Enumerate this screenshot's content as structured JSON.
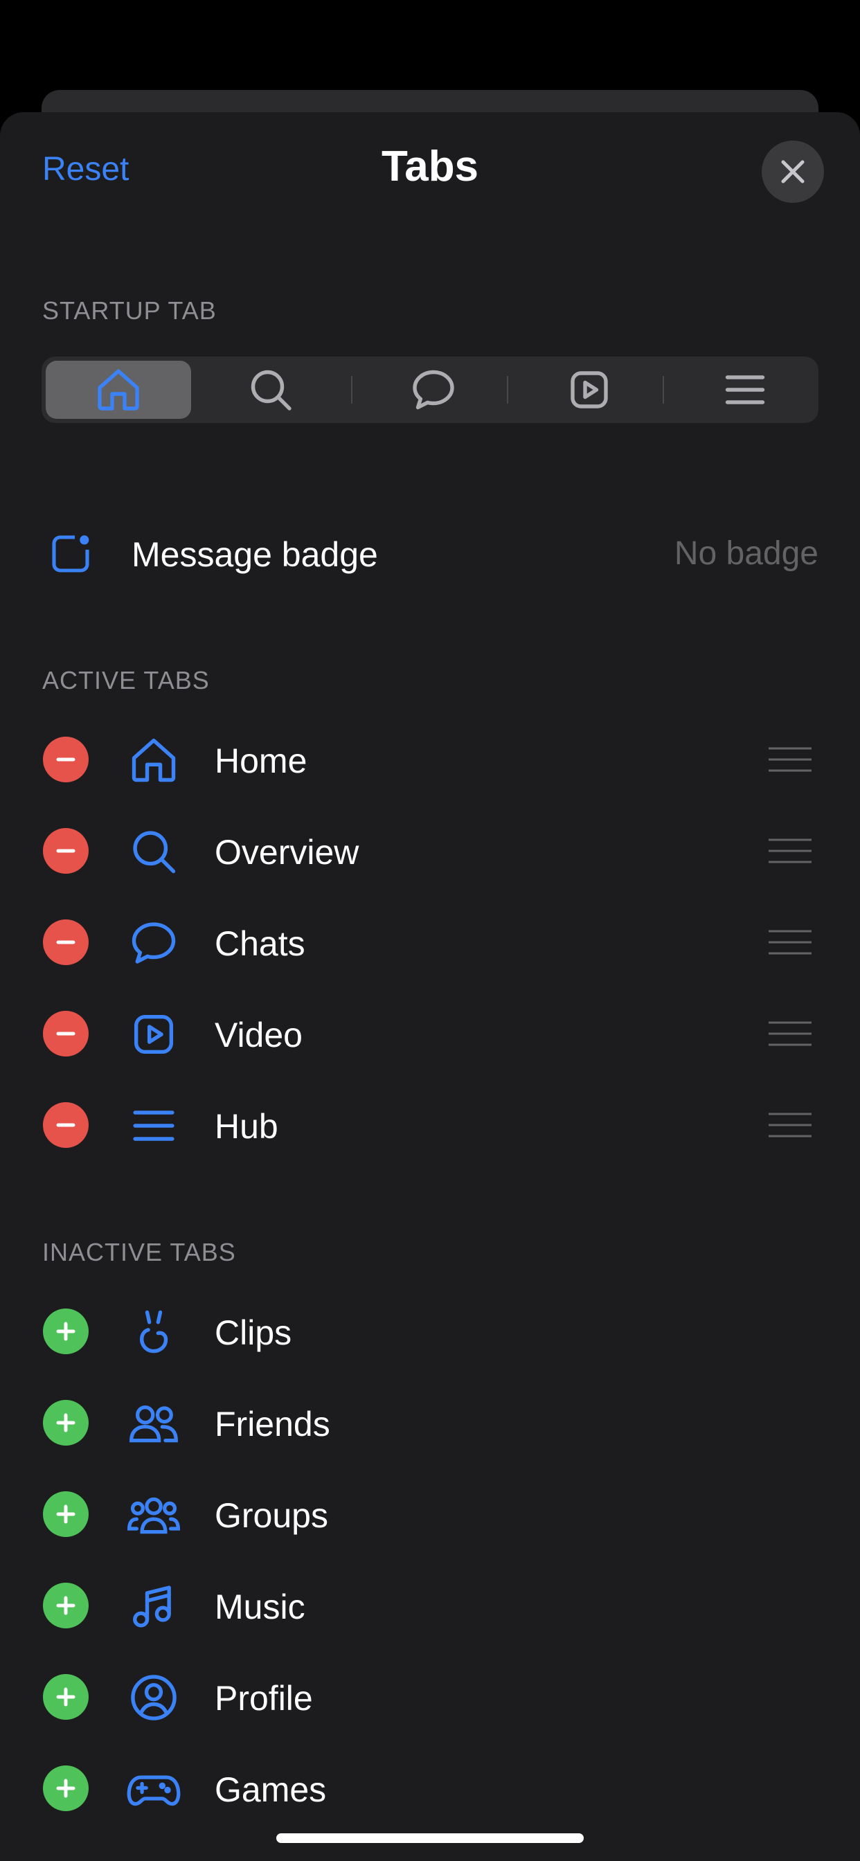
{
  "header": {
    "reset_label": "Reset",
    "title": "Tabs",
    "close_icon": "close-icon"
  },
  "startup": {
    "section_title": "STARTUP TAB",
    "selected": "home",
    "options": [
      "home-icon",
      "search-icon",
      "chat-icon",
      "video-icon",
      "hub-icon"
    ]
  },
  "badge": {
    "icon": "badge-icon",
    "label": "Message badge",
    "value": "No badge"
  },
  "active": {
    "section_title": "ACTIVE TABS",
    "items": [
      {
        "label": "Home",
        "icon": "home-icon"
      },
      {
        "label": "Overview",
        "icon": "search-icon"
      },
      {
        "label": "Chats",
        "icon": "chat-icon"
      },
      {
        "label": "Video",
        "icon": "video-icon"
      },
      {
        "label": "Hub",
        "icon": "hub-icon"
      }
    ]
  },
  "inactive": {
    "section_title": "INACTIVE TABS",
    "items": [
      {
        "label": "Clips",
        "icon": "clips-icon"
      },
      {
        "label": "Friends",
        "icon": "friends-icon"
      },
      {
        "label": "Groups",
        "icon": "groups-icon"
      },
      {
        "label": "Music",
        "icon": "music-icon"
      },
      {
        "label": "Profile",
        "icon": "profile-icon"
      },
      {
        "label": "Games",
        "icon": "games-icon"
      }
    ]
  },
  "colors": {
    "accent": "#3b82f6",
    "remove": "#e5534b",
    "add": "#4fc25a",
    "background": "#1c1c1e"
  }
}
